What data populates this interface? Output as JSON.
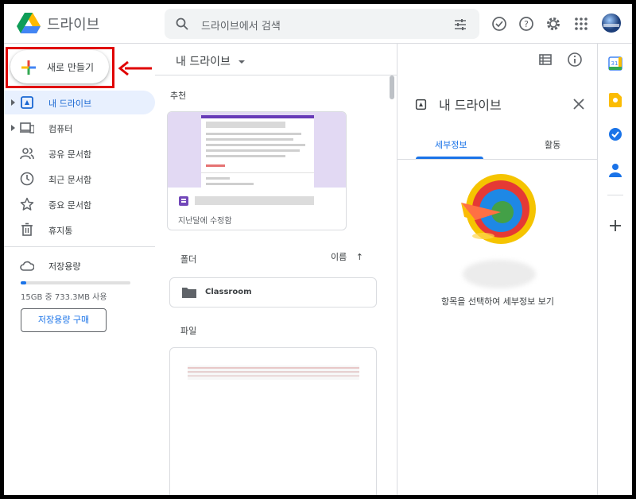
{
  "app": {
    "name": "드라이브"
  },
  "search": {
    "placeholder": "드라이브에서 검색"
  },
  "sidebar": {
    "new_button": "새로 만들기",
    "items": [
      {
        "label": "내 드라이브",
        "icon": "my-drive-icon",
        "active": true,
        "expandable": true
      },
      {
        "label": "컴퓨터",
        "icon": "computer-icon",
        "active": false,
        "expandable": true
      },
      {
        "label": "공유 문서함",
        "icon": "shared-icon",
        "active": false,
        "expandable": false
      },
      {
        "label": "최근 문서함",
        "icon": "clock-icon",
        "active": false,
        "expandable": false
      },
      {
        "label": "중요 문서함",
        "icon": "star-icon",
        "active": false,
        "expandable": false
      },
      {
        "label": "휴지통",
        "icon": "trash-icon",
        "active": false,
        "expandable": false
      }
    ],
    "storage": {
      "label": "저장용량",
      "usage_text": "15GB 중 733.3MB 사용",
      "used_fraction": 0.048,
      "buy_button": "저장용량 구매"
    }
  },
  "main": {
    "title": "내 드라이브",
    "suggested_label": "추천",
    "suggested_card": {
      "modified": "지난달에 수정함"
    },
    "folders_label": "폴더",
    "sort_label": "이름",
    "folders": [
      {
        "name": "Classroom"
      }
    ],
    "files_label": "파일"
  },
  "details": {
    "title": "내 드라이브",
    "tabs": [
      {
        "label": "세부정보",
        "active": true
      },
      {
        "label": "활동",
        "active": false
      }
    ],
    "empty_text": "항목을 선택하여 세부정보 보기"
  },
  "side_apps": {
    "calendar_day": "31"
  },
  "colors": {
    "accent": "#1a73e8",
    "active_bg": "#e8f0fe",
    "annotation_red": "#e00000"
  }
}
